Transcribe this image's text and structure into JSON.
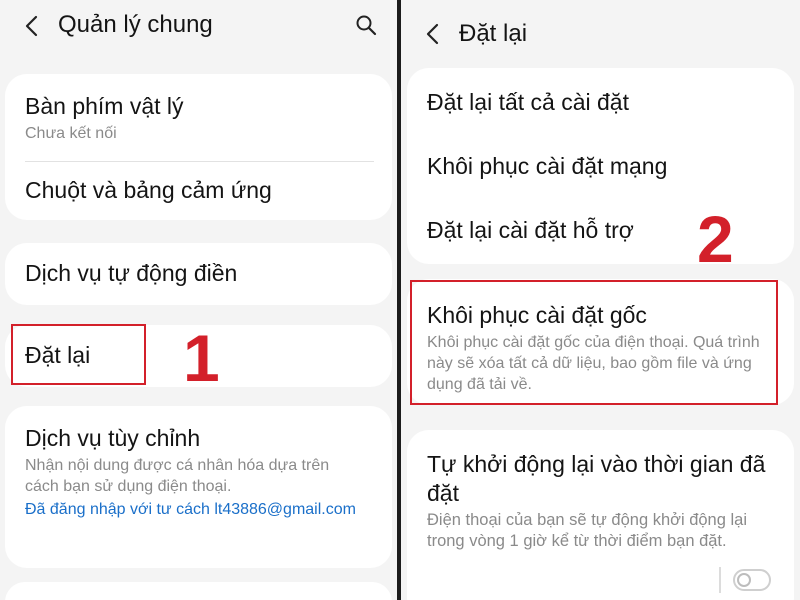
{
  "left_screen": {
    "title": "Quản lý chung",
    "items": {
      "physical_keyboard": {
        "title": "Bàn phím vật lý",
        "subtitle": "Chưa kết nối"
      },
      "mouse_trackpad": {
        "title": "Chuột và bảng cảm ứng"
      },
      "autofill": {
        "title": "Dịch vụ tự động điền"
      },
      "reset": {
        "title": "Đặt lại"
      },
      "customization": {
        "title": "Dịch vụ tùy chỉnh",
        "subtitle": "Nhận nội dung được cá nhân hóa dựa trên cách bạn sử dụng điện thoại.",
        "account": "Đã đăng nhập với tư cách lt43886@gmail.com"
      }
    },
    "step_label": "1"
  },
  "right_screen": {
    "title": "Đặt lại",
    "items": {
      "reset_all": {
        "title": "Đặt lại tất cả cài đặt"
      },
      "reset_network": {
        "title": "Khôi phục cài đặt mạng"
      },
      "reset_accessibility": {
        "title": "Đặt lại cài đặt hỗ trợ"
      },
      "factory_reset": {
        "title": "Khôi phục cài đặt gốc",
        "subtitle": "Khôi phục cài đặt gốc của điện thoại. Quá trình này sẽ xóa tất cả dữ liệu, bao gồm file và ứng dụng đã tải về."
      },
      "auto_restart": {
        "title": "Tự khởi động lại vào thời gian đã đặt",
        "subtitle": "Điện thoại của bạn sẽ tự động khởi động lại trong vòng 1 giờ kể từ thời điểm bạn đặt.",
        "toggle_on": false
      }
    },
    "step_label": "2"
  },
  "colors": {
    "highlight": "#d3202a",
    "link": "#1a6fc9",
    "background": "#f4f4f4",
    "card": "#ffffff"
  },
  "icons": {
    "back": "chevron-left-icon",
    "search": "search-icon"
  }
}
